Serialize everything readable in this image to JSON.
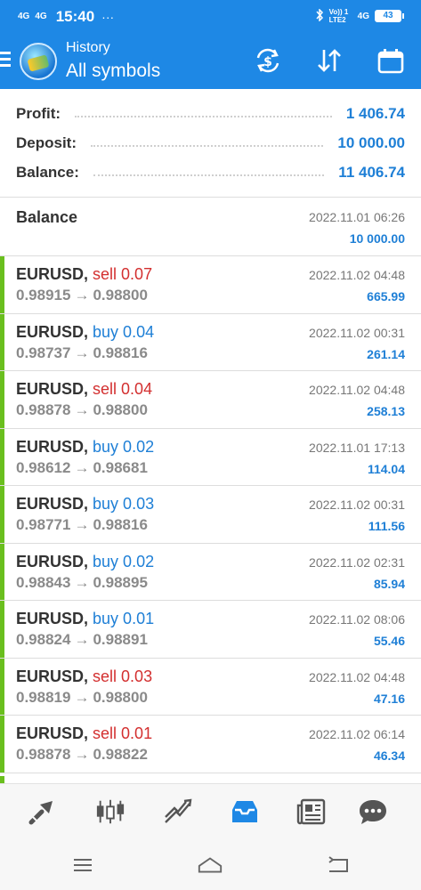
{
  "status_bar": {
    "signal1": "4G",
    "signal2": "4G",
    "time": "15:40",
    "more": "···",
    "volte": "Vo)) 1 LTE2",
    "net": "4G",
    "battery": "43"
  },
  "header": {
    "subtitle": "History",
    "title": "All symbols",
    "icons": [
      "currency-exchange-icon",
      "sort-icon",
      "calendar-icon"
    ],
    "color": "#1e88e5"
  },
  "summary": {
    "profit_label": "Profit:",
    "profit_value": "1 406.74",
    "deposit_label": "Deposit:",
    "deposit_value": "10 000.00",
    "balance_label": "Balance:",
    "balance_value": "11 406.74"
  },
  "balance_entry": {
    "name": "Balance",
    "time": "2022.11.01 06:26",
    "amount": "10 000.00"
  },
  "trades": [
    {
      "symbol": "EURUSD,",
      "side": "sell",
      "label": "sell 0.07",
      "open": "0.98915",
      "close": "0.98800",
      "time": "2022.11.02 04:48",
      "profit": "665.99"
    },
    {
      "symbol": "EURUSD,",
      "side": "buy",
      "label": "buy 0.04",
      "open": "0.98737",
      "close": "0.98816",
      "time": "2022.11.02 00:31",
      "profit": "261.14"
    },
    {
      "symbol": "EURUSD,",
      "side": "sell",
      "label": "sell 0.04",
      "open": "0.98878",
      "close": "0.98800",
      "time": "2022.11.02 04:48",
      "profit": "258.13"
    },
    {
      "symbol": "EURUSD,",
      "side": "buy",
      "label": "buy 0.02",
      "open": "0.98612",
      "close": "0.98681",
      "time": "2022.11.01 17:13",
      "profit": "114.04"
    },
    {
      "symbol": "EURUSD,",
      "side": "buy",
      "label": "buy 0.03",
      "open": "0.98771",
      "close": "0.98816",
      "time": "2022.11.02 00:31",
      "profit": "111.56"
    },
    {
      "symbol": "EURUSD,",
      "side": "buy",
      "label": "buy 0.02",
      "open": "0.98843",
      "close": "0.98895",
      "time": "2022.11.02 02:31",
      "profit": "85.94"
    },
    {
      "symbol": "EURUSD,",
      "side": "buy",
      "label": "buy 0.01",
      "open": "0.98824",
      "close": "0.98891",
      "time": "2022.11.02 08:06",
      "profit": "55.46"
    },
    {
      "symbol": "EURUSD,",
      "side": "sell",
      "label": "sell 0.03",
      "open": "0.98819",
      "close": "0.98800",
      "time": "2022.11.02 04:48",
      "profit": "47.16"
    },
    {
      "symbol": "EURUSD,",
      "side": "sell",
      "label": "sell 0.01",
      "open": "0.98878",
      "close": "0.98822",
      "time": "2022.11.02 06:14",
      "profit": "46.34"
    }
  ],
  "arrow": "→",
  "colors": {
    "accent": "#1e88e5",
    "profit_blue": "#1e7fd6",
    "sell_red": "#d32f2f",
    "win_bar_green": "#6abf1e"
  },
  "bottom_nav": [
    "quotes-icon",
    "chart-icon",
    "trade-icon",
    "history-icon",
    "news-icon",
    "messages-icon"
  ],
  "active_tab": "history-icon",
  "system_nav": [
    "recent-apps-icon",
    "home-icon",
    "back-icon"
  ]
}
